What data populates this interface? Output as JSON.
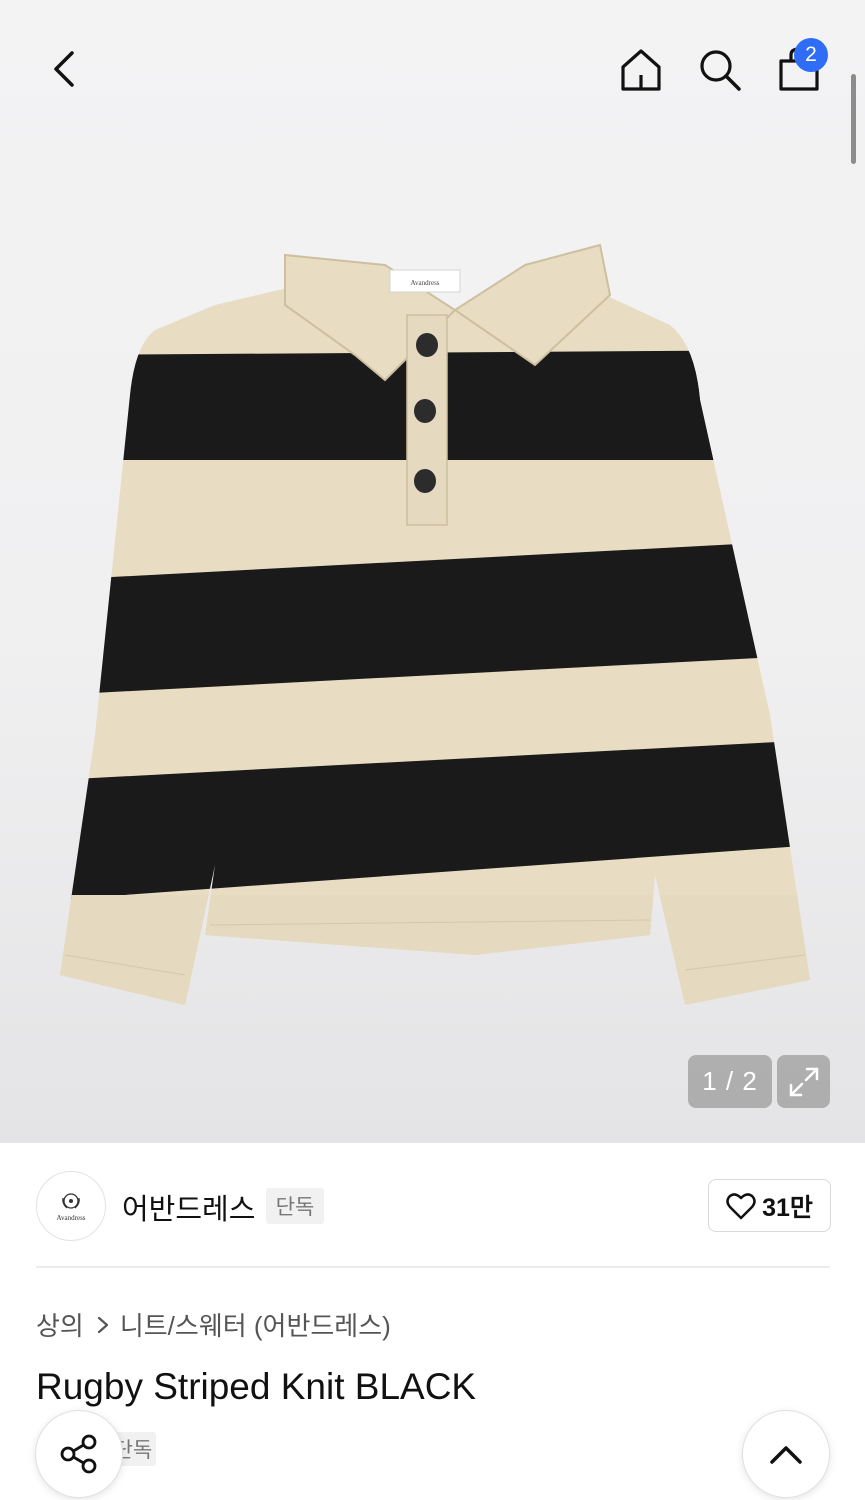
{
  "header": {
    "cart_count": "2",
    "icons": [
      "back-arrow",
      "home",
      "search",
      "shopping-bag"
    ],
    "badge_color": "#2f6df6"
  },
  "gallery": {
    "page_indicator": "1 / 2",
    "image_label": "Avandress",
    "image_description_colors": {
      "cream": "#e8dcc2",
      "black": "#1a1a1a"
    }
  },
  "brand": {
    "name": "어반드레스",
    "tag": "단독",
    "logo_text": "Avandress",
    "likes": "31만"
  },
  "product": {
    "breadcrumb": [
      "상의",
      "니트/스웨터 (어반드레스)"
    ],
    "title": "Rugby Striped Knit BLACK",
    "tag": "단독"
  },
  "actions": {
    "share_icon": "share",
    "scroll_top_icon": "chevron-up"
  }
}
